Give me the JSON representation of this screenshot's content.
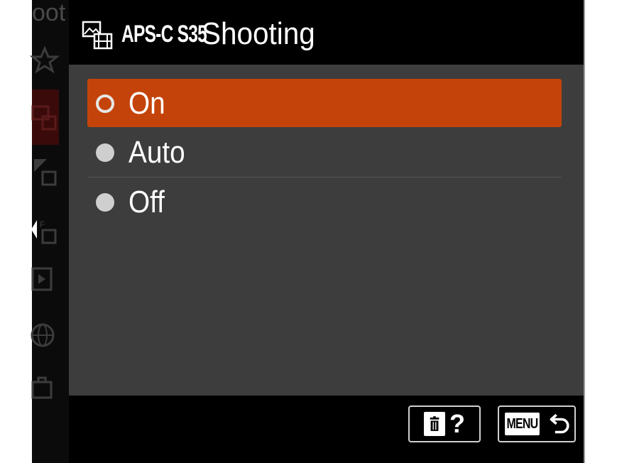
{
  "background_menu": {
    "title_fragment": "oot",
    "side_icons": [
      "star-icon",
      "camera-movie-icon",
      "exposure-movie-icon",
      "focus-movie-icon",
      "playback-icon",
      "globe-icon",
      "toolbox-icon"
    ]
  },
  "header": {
    "icon": "photo-movie-icon",
    "title_prefix": "APS-C S35",
    "title_word": "Shooting"
  },
  "options": [
    {
      "label": "On",
      "selected": true
    },
    {
      "label": "Auto",
      "selected": false
    },
    {
      "label": "Off",
      "selected": false
    }
  ],
  "footer": {
    "help_button": {
      "icon": "trash-icon",
      "label": "?"
    },
    "back_button": {
      "label": "MENU",
      "icon": "return-arrow-icon"
    }
  },
  "colors": {
    "accent": "#c4430a",
    "panel": "#3d3d3d",
    "header": "#000000"
  }
}
